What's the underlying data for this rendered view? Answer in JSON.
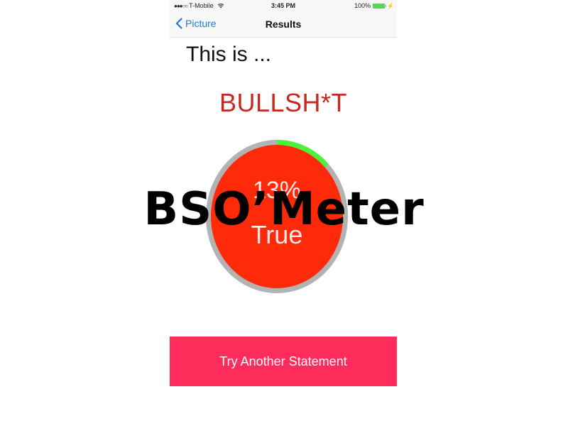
{
  "status_bar": {
    "signal": "●●●○○",
    "carrier": "T-Mobile",
    "time": "3:45 PM",
    "battery_percent": "100%",
    "icons": [
      "wifi-icon",
      "battery-icon",
      "charging-icon"
    ]
  },
  "nav": {
    "back_label": "Picture",
    "title": "Results"
  },
  "content": {
    "intro": "This is ...",
    "verdict": "BULLSH*T"
  },
  "gauge": {
    "percent_label": "13%",
    "caption": "True",
    "value": 0.13
  },
  "actions": {
    "try_again_label": "Try Another Statement"
  },
  "overlay": {
    "title": "BSO’Meter"
  },
  "colors": {
    "accent_blue": "#1a7bdc",
    "verdict_red": "#c8281e",
    "gauge_fill": "#ff2a0a",
    "gauge_track": "#b3b3b3",
    "gauge_progress": "#4cf23a",
    "button_pink": "#fe2c5b",
    "battery_green": "#4cd964"
  }
}
